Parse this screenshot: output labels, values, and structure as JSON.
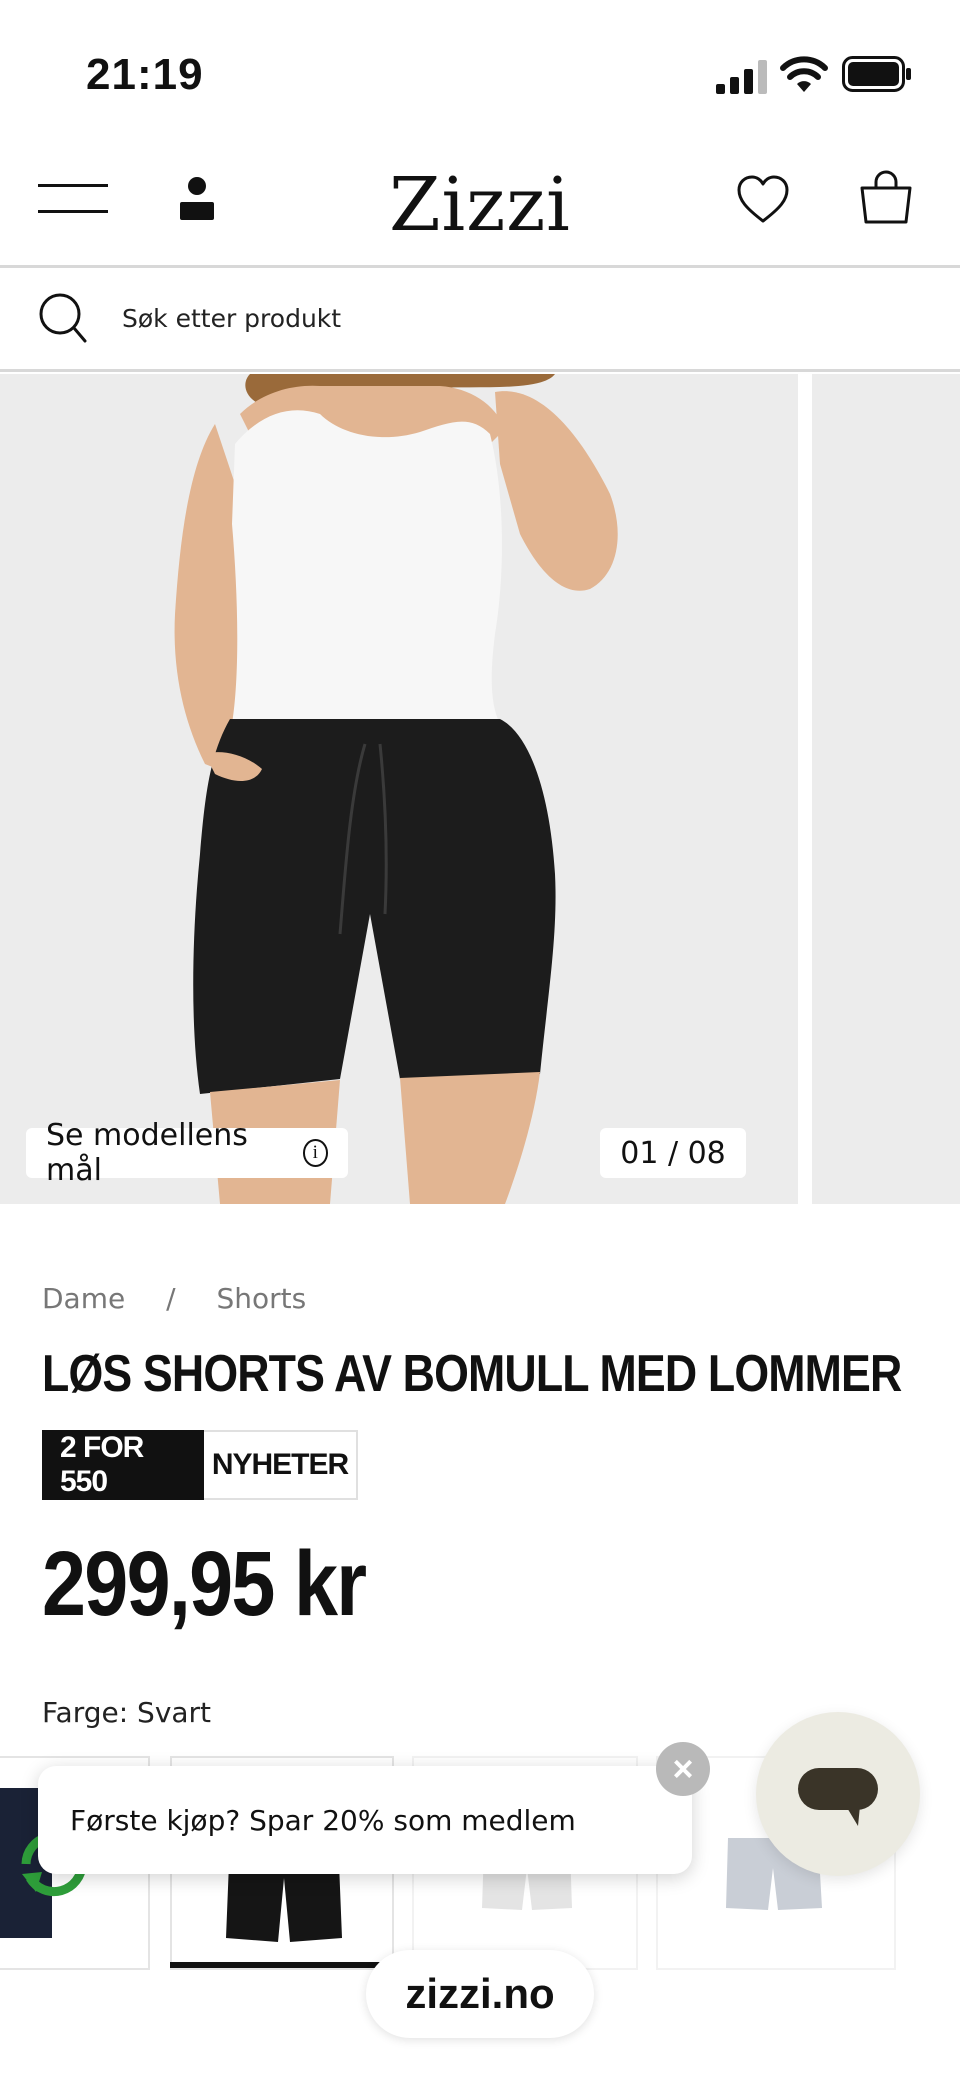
{
  "status_bar": {
    "time": "21:19"
  },
  "header": {
    "logo": "Zizzi"
  },
  "search": {
    "placeholder": "Søk etter produkt"
  },
  "gallery": {
    "measure_label": "Se modellens mål",
    "counter": "01 /  08",
    "info_glyph": "i"
  },
  "breadcrumb": {
    "items": [
      "Dame",
      "Shorts"
    ],
    "separator": "/"
  },
  "product": {
    "title": "LØS SHORTS AV BOMULL MED LOMMER",
    "badges": [
      "2 FOR 550",
      "NYHETER"
    ],
    "price": "299,95 kr",
    "color_label": "Farge: Svart"
  },
  "promo": {
    "text": "Første kjøp? Spar 20% som medlem",
    "close_glyph": "×"
  },
  "browser": {
    "url": "zizzi.no"
  },
  "colors": {
    "accent": "#111111",
    "background": "#ffffff",
    "chat_bg": "#ecebe2",
    "chat_bubble": "#3a3428"
  }
}
